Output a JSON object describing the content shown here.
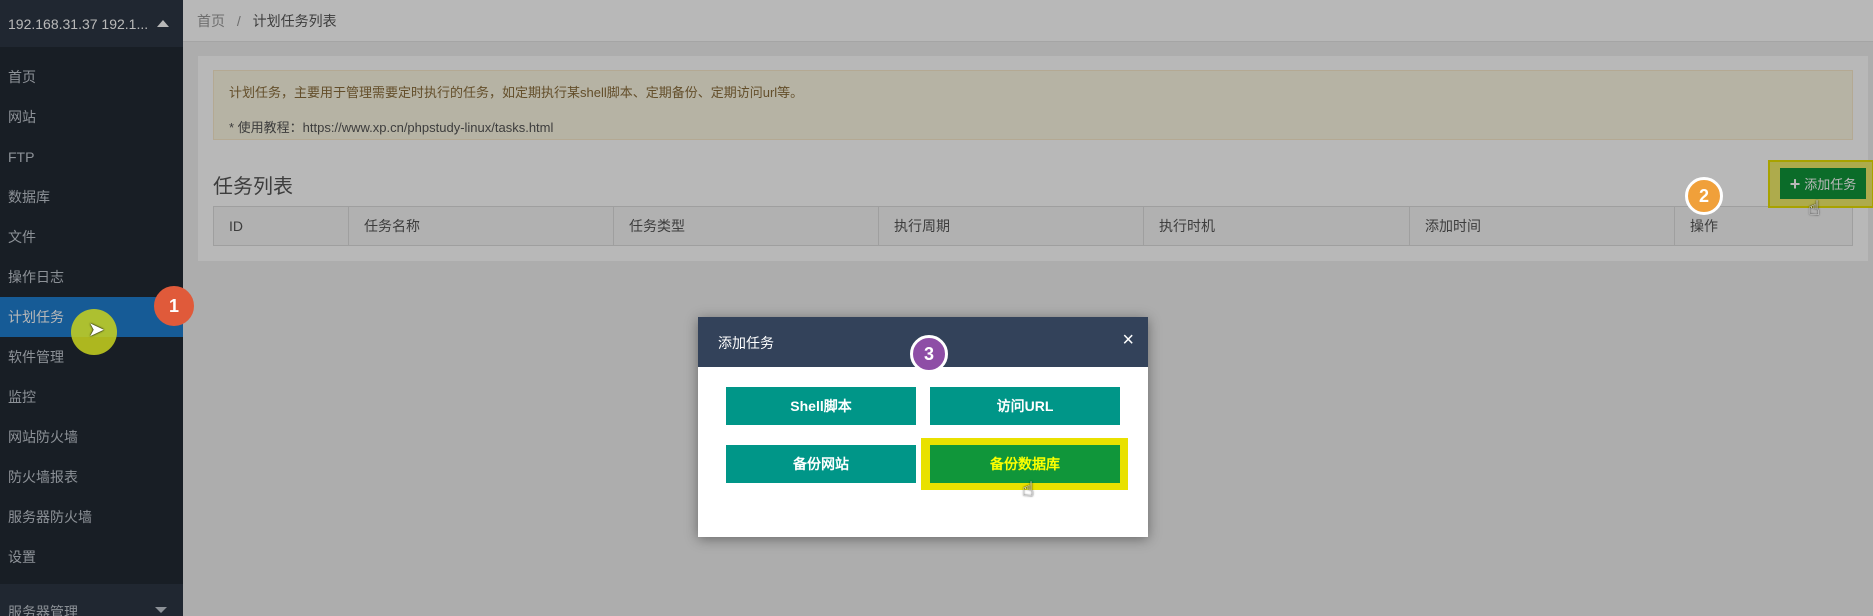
{
  "sidebar": {
    "server_label": "192.168.31.37 192.1...",
    "items": [
      {
        "label": "首页"
      },
      {
        "label": "网站"
      },
      {
        "label": "FTP"
      },
      {
        "label": "数据库"
      },
      {
        "label": "文件"
      },
      {
        "label": "操作日志"
      },
      {
        "label": "计划任务",
        "active": true
      },
      {
        "label": "软件管理"
      },
      {
        "label": "监控"
      },
      {
        "label": "网站防火墙"
      },
      {
        "label": "防火墙报表"
      },
      {
        "label": "服务器防火墙"
      },
      {
        "label": "设置"
      }
    ],
    "footer_label": "服务器管理"
  },
  "breadcrumb": {
    "home": "首页",
    "separator": "/",
    "current": "计划任务列表"
  },
  "notice": {
    "line1": "计划任务，主要用于管理需要定时执行的任务，如定期执行某shell脚本、定期备份、定期访问url等。",
    "line2": "* 使用教程：https://www.xp.cn/phpstudy-linux/tasks.html"
  },
  "task_list": {
    "title": "任务列表",
    "add_button": "添加任务",
    "columns": [
      "ID",
      "任务名称",
      "任务类型",
      "执行周期",
      "执行时机",
      "添加时间",
      "操作"
    ]
  },
  "modal": {
    "title": "添加任务",
    "close": "×",
    "buttons": {
      "shell": "Shell脚本",
      "url": "访问URL",
      "backup_site": "备份网站",
      "backup_db": "备份数据库"
    }
  },
  "annotations": {
    "step1": "1",
    "step2": "2",
    "step3": "3"
  },
  "colors": {
    "sidebar_bg": "#222a34",
    "active_item": "#1f7ed0",
    "modal_header": "#33425a",
    "teal_button": "#009688",
    "green_button": "#10963a",
    "highlight": "#e9e100"
  }
}
